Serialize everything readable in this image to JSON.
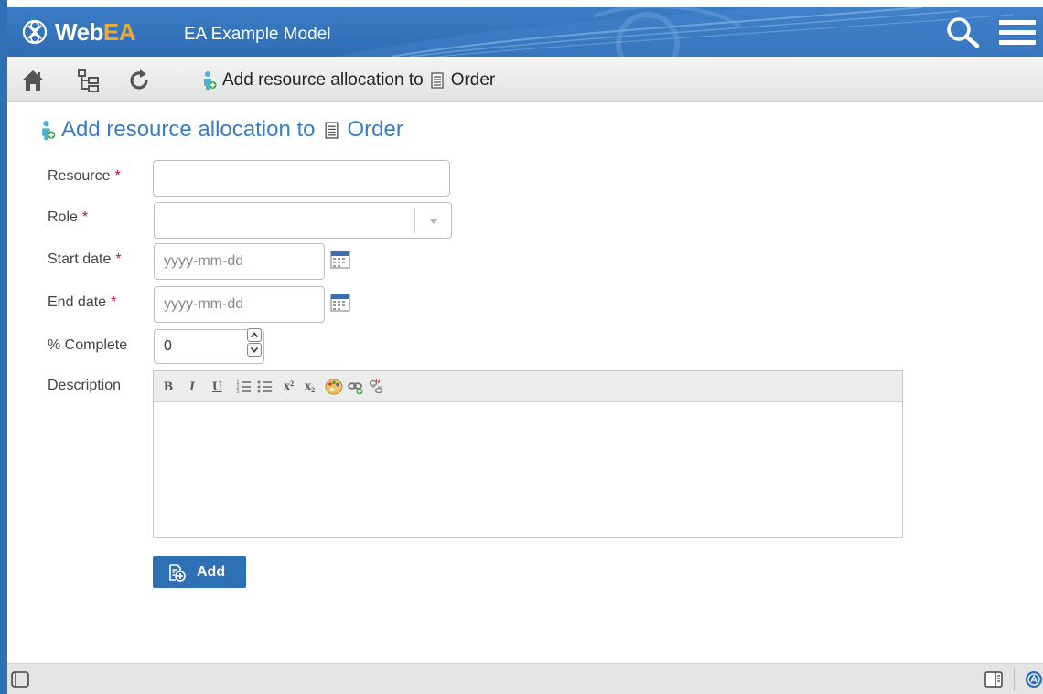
{
  "header": {
    "brand_web": "Web",
    "brand_ea": "EA",
    "model_name": "EA Example Model",
    "colors": {
      "bar": "#2f6fb6",
      "brand_accent": "#f0a830"
    },
    "icons": [
      "webea-logo-icon",
      "search-icon",
      "hamburger-menu-icon"
    ]
  },
  "toolbar": {
    "icons": [
      "home-icon",
      "tree-browser-icon",
      "refresh-icon"
    ],
    "title_prefix": "Add resource allocation to",
    "title_element": "Order"
  },
  "page": {
    "title_prefix": "Add resource allocation to",
    "title_element": "Order",
    "title_color": "#3a7cc4"
  },
  "form": {
    "resource": {
      "label": "Resource",
      "required_mark": "*",
      "value": ""
    },
    "role": {
      "label": "Role",
      "required_mark": "*",
      "selected": ""
    },
    "start_date": {
      "label": "Start date",
      "required_mark": "*",
      "placeholder": "yyyy-mm-dd",
      "value": ""
    },
    "end_date": {
      "label": "End date",
      "required_mark": "*",
      "placeholder": "yyyy-mm-dd",
      "value": ""
    },
    "percent_complete": {
      "label": "% Complete",
      "value": "0"
    },
    "description": {
      "label": "Description",
      "toolbar": {
        "bold": "B",
        "italic": "I",
        "underline": "U",
        "superscript": "x²",
        "subscript": "x₂"
      },
      "value": ""
    },
    "submit_label": "Add"
  },
  "statusbar": {
    "icons": [
      "panel-toggle-icon",
      "properties-panel-icon",
      "status-indicator-icon"
    ]
  }
}
